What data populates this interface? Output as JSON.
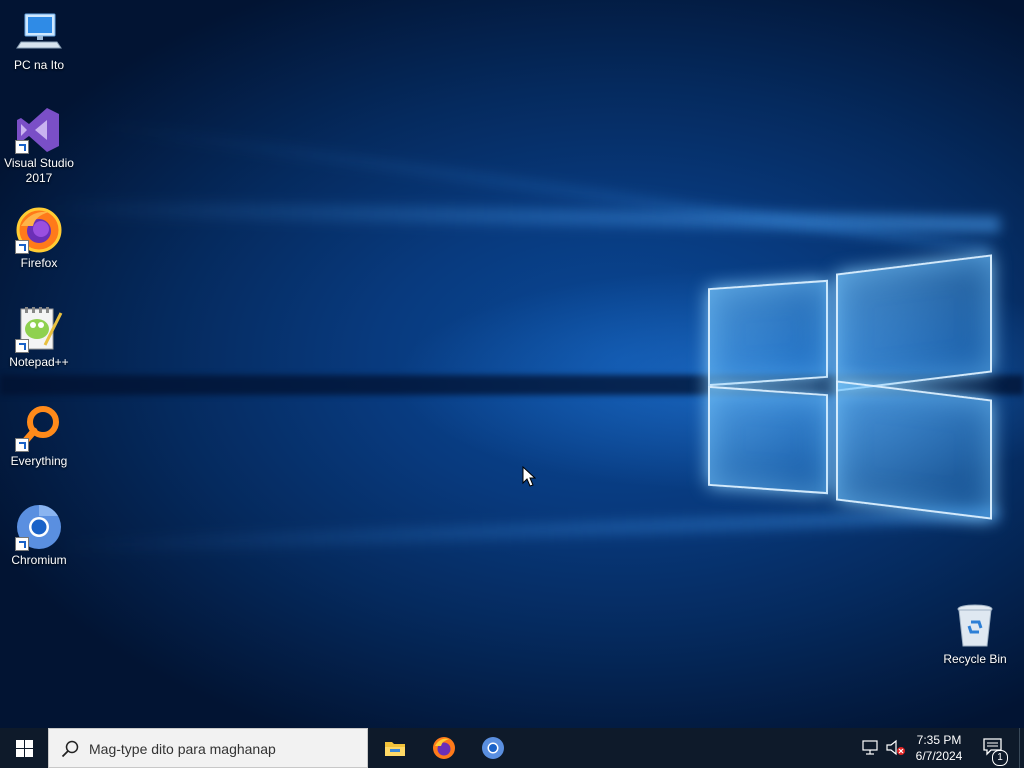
{
  "desktop": {
    "icons": [
      {
        "label": "PC na Ito",
        "icon": "computer-icon"
      },
      {
        "label": "Visual Studio 2017",
        "icon": "visual-studio-icon"
      },
      {
        "label": "Firefox",
        "icon": "firefox-icon"
      },
      {
        "label": "Notepad++",
        "icon": "notepad-plus-plus-icon"
      },
      {
        "label": "Everything",
        "icon": "everything-icon"
      },
      {
        "label": "Chromium",
        "icon": "chromium-icon"
      }
    ],
    "recycle_bin": {
      "label": "Recycle Bin",
      "icon": "recycle-bin-icon"
    }
  },
  "taskbar": {
    "search_placeholder": "Mag-type dito para maghanap",
    "pinned": [
      "file-explorer-icon",
      "firefox-icon",
      "chromium-icon"
    ],
    "clock": {
      "time": "7:35 PM",
      "date": "6/7/2024"
    },
    "notification_count": "1"
  },
  "colors": {
    "accent": "#0078d7",
    "taskbar": "#0e1a2a"
  }
}
